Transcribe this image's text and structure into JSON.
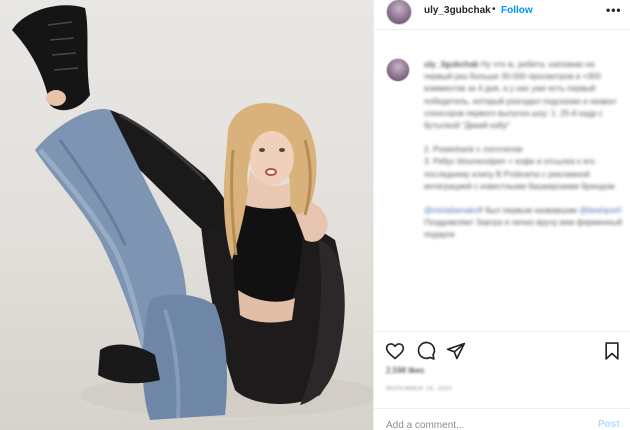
{
  "post": {
    "username": "uly_3gubchak",
    "follow_label": "Follow",
    "separator": "•",
    "more_label": "•••"
  },
  "caption": {
    "username": "uly_3gubchak",
    "paragraph_1": "Ну что ж, ребята, напомню на первый раз больше 30.000 просмотров и +300 комментов за 4 дня, а у нас уже есть первый победитель, который разгадал подсказки и назвал спонсоров первого выпуска шоу: 1. 25-й кадр с бутылкой \"Дикий кабу\"",
    "paragraph_2": "2. Powerbank с логотипом",
    "paragraph_3": "3. Ребус klounexstpen + кофе и отсылка к его последнему клипу В Probrama с рекламной интеграцией с известными башкирскими брендом",
    "mention_1": "@mirialiamakoff",
    "mention_text": "был первым назвавшим",
    "mention_2": "@beshport!",
    "paragraph_5": "Поздравляю! Завтра я лично вручу вам фирменный подарок"
  },
  "engagement": {
    "likes": "2,598 likes",
    "date": "NOVEMBER 18, 2020"
  },
  "comment": {
    "placeholder": "Add a comment...",
    "post_label": "Post"
  },
  "colors": {
    "link": "#0095f6",
    "post_disabled": "#b3dbff",
    "border": "#efefef"
  },
  "icons": [
    "heart-icon",
    "comment-icon",
    "share-icon",
    "bookmark-icon",
    "more-options-icon"
  ]
}
